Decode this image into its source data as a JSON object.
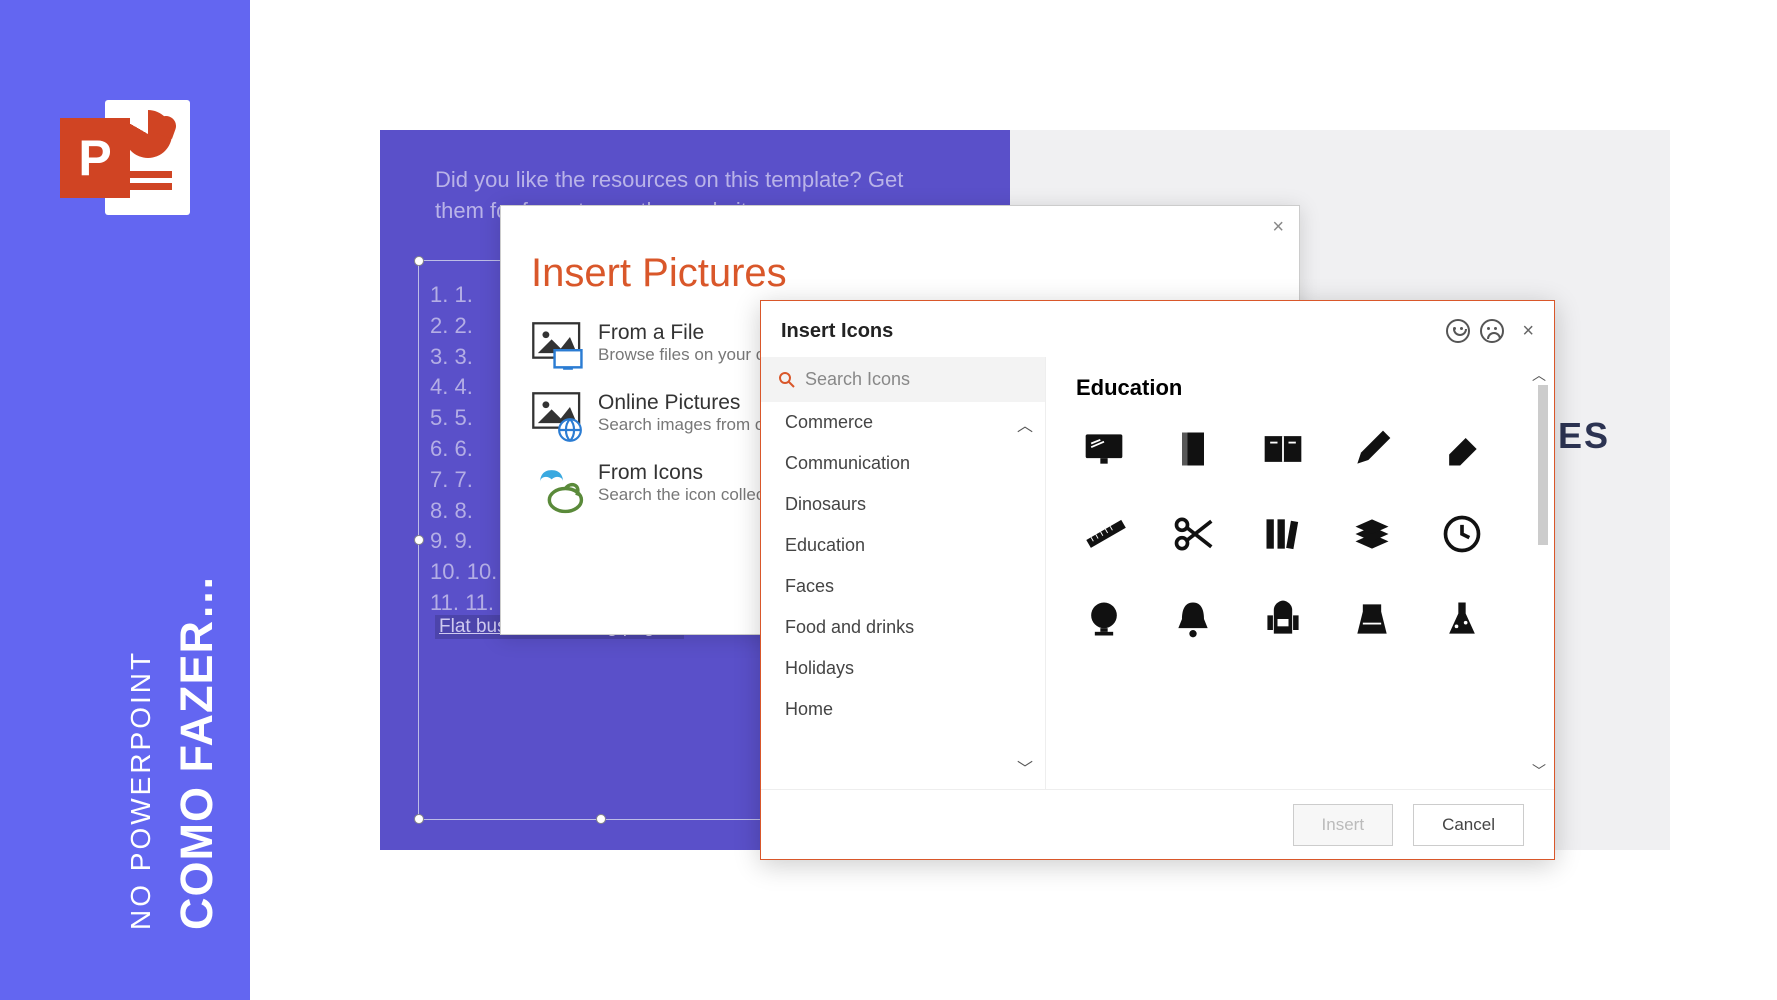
{
  "banner": {
    "title": "COMO FAZER…",
    "subtitle": "NO POWERPOINT"
  },
  "slide": {
    "message": "Did you like the resources on this template? Get them for free at our other websit",
    "list_items": [
      "1.",
      "2.",
      "3.",
      "4.",
      "5.",
      "6.",
      "7.",
      "8.",
      "9.",
      "10.",
      "11."
    ],
    "flat_link": "Flat business landing page c",
    "urces": "URCES"
  },
  "insert_pictures": {
    "title": "Insert Pictures",
    "options": [
      {
        "title": "From a File",
        "desc": "Browse files on your c",
        "icon": "file-picture"
      },
      {
        "title": "Online Pictures",
        "desc": "Search images from o",
        "icon": "online-picture"
      },
      {
        "title": "From Icons",
        "desc": "Search the icon collec",
        "icon": "from-icons"
      }
    ]
  },
  "insert_icons": {
    "title": "Insert Icons",
    "search_placeholder": "Search Icons",
    "categories": [
      "Commerce",
      "Communication",
      "Dinosaurs",
      "Education",
      "Faces",
      "Food and drinks",
      "Holidays",
      "Home"
    ],
    "grid_heading": "Education",
    "icons": [
      "chalkboard",
      "notebook",
      "open-book",
      "pencil",
      "eraser",
      "ruler",
      "scissors",
      "book-stack",
      "books",
      "clock",
      "globe",
      "bell",
      "backpack",
      "beaker",
      "flask"
    ],
    "buttons": {
      "insert": "Insert",
      "cancel": "Cancel"
    }
  }
}
